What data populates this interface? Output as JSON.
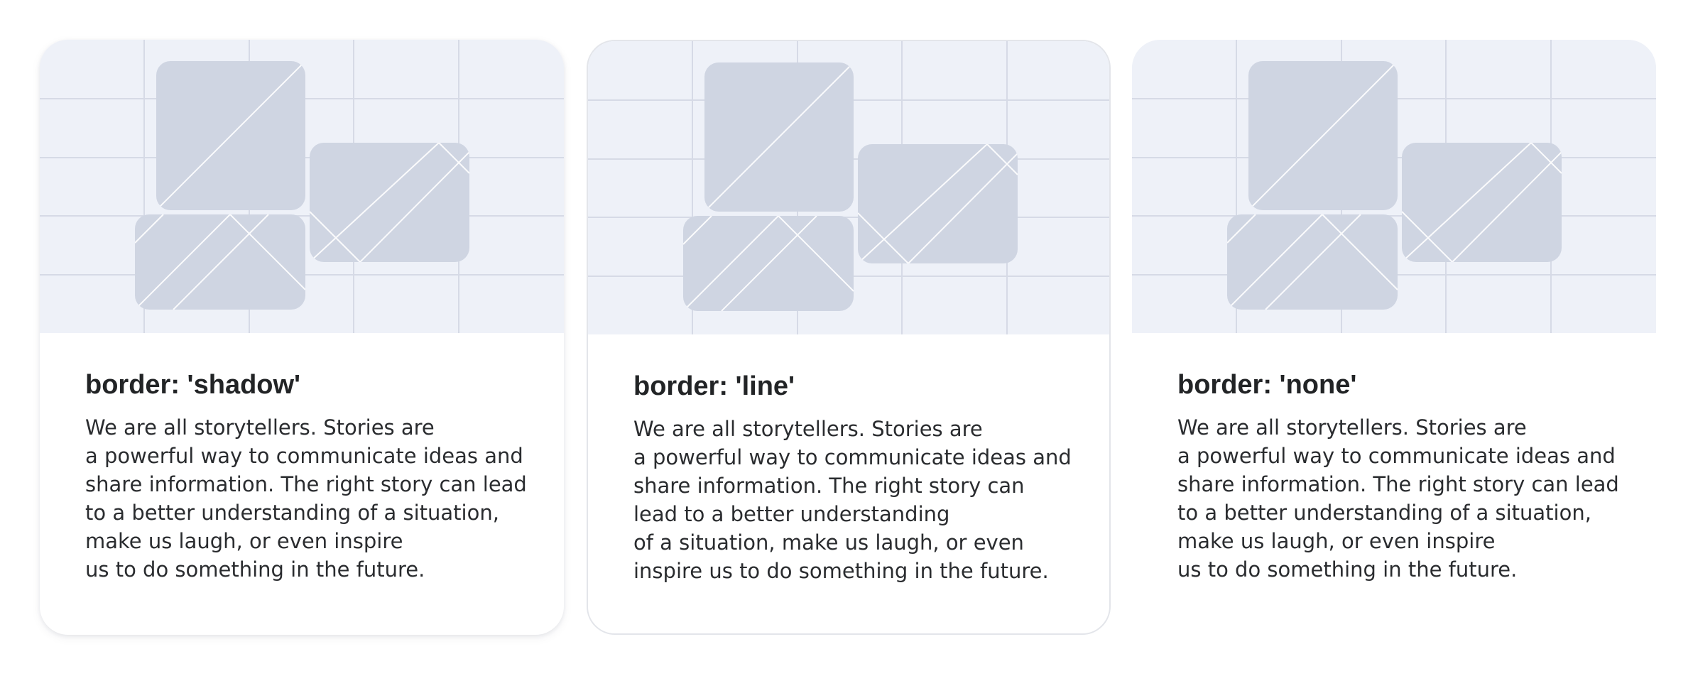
{
  "colors": {
    "media_background": "#eef1f8",
    "grid_line": "#d6dae6",
    "placeholder_shape": "#cfd5e2",
    "title_text": "#222426",
    "body_text": "#2a2c2f",
    "card_border": "#e3e5ea"
  },
  "icons": {
    "media": "image-placeholder-illustration"
  },
  "cards": [
    {
      "title": "border: 'shadow'",
      "lines": [
        "We are all storytellers. Stories are",
        "a powerful way to communicate ideas and",
        "share information. The right story can lead",
        "to a better understanding of a situation,",
        "make us laugh, or even inspire",
        "us to do something in the future."
      ]
    },
    {
      "title": "border: 'line'",
      "lines": [
        "We are all storytellers. Stories are",
        "a powerful way to communicate ideas and",
        "share information. The right story can",
        "lead to a better understanding",
        "of a situation, make us laugh, or even",
        "inspire us to do something in the future."
      ]
    },
    {
      "title": "border: 'none'",
      "lines": [
        "We are all storytellers. Stories are",
        "a powerful way to communicate ideas and",
        "share information. The right story can lead",
        "to a better understanding of a situation,",
        "make us laugh, or even inspire",
        "us to do something in the future."
      ]
    }
  ]
}
